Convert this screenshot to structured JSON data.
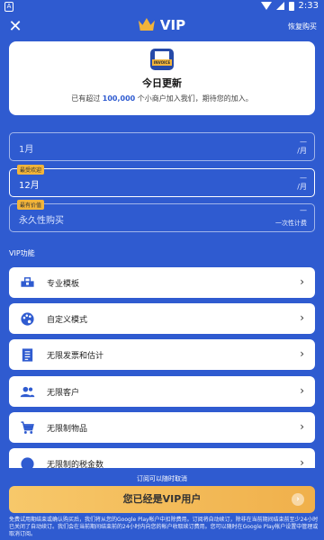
{
  "status_bar": {
    "left_glyph": "A",
    "time": "2:33"
  },
  "header": {
    "close_glyph": "✕",
    "title": "VIP",
    "restore_label": "恢复购买"
  },
  "top_card": {
    "icon_text": "INVOICE",
    "title": "今日更新",
    "subtitle_prefix": "已有超过 ",
    "subtitle_highlight": "100,000",
    "subtitle_suffix": " 个小商户加入我们，期待您的加入。"
  },
  "plans": [
    {
      "name": "1月",
      "badge": "",
      "per_line1": "—",
      "per_line2": "/月"
    },
    {
      "name": "12月",
      "badge": "最受欢迎",
      "per_line1": "—",
      "per_line2": "/月",
      "selected": true
    },
    {
      "name": "永久性购买",
      "badge": "最有价值",
      "per_line1": "—",
      "per_line2": "一次性计费"
    }
  ],
  "features_title": "VIP功能",
  "features": [
    {
      "label": "专业模板",
      "icon": "toolbox-icon"
    },
    {
      "label": "自定义模式",
      "icon": "palette-icon"
    },
    {
      "label": "无限发票和估计",
      "icon": "receipt-icon"
    },
    {
      "label": "无限客户",
      "icon": "people-icon"
    },
    {
      "label": "无限制物品",
      "icon": "cart-icon"
    },
    {
      "label": "无限制的税金数",
      "icon": "tax-icon"
    }
  ],
  "chevron": "›",
  "cancel_note": "订阅可以随时取消",
  "vip_button": {
    "label": "您已经是VIP用户",
    "arrow": "›"
  },
  "disclaimer": "免费试用期结束或确认购买后，我们将从您的Google Play帐户中扣除费用。订阅将自动续订，除非在当前期间结束前至少24小时已关闭了自动续订。我们会在当前期间结束前的24小时内向您的帐户收取续订费用。您可以随时在Google Play帐户设置中管理或取消订阅。",
  "colors": {
    "primary": "#2f5bd0",
    "accent": "#f2b43a",
    "card": "#ffffff"
  }
}
